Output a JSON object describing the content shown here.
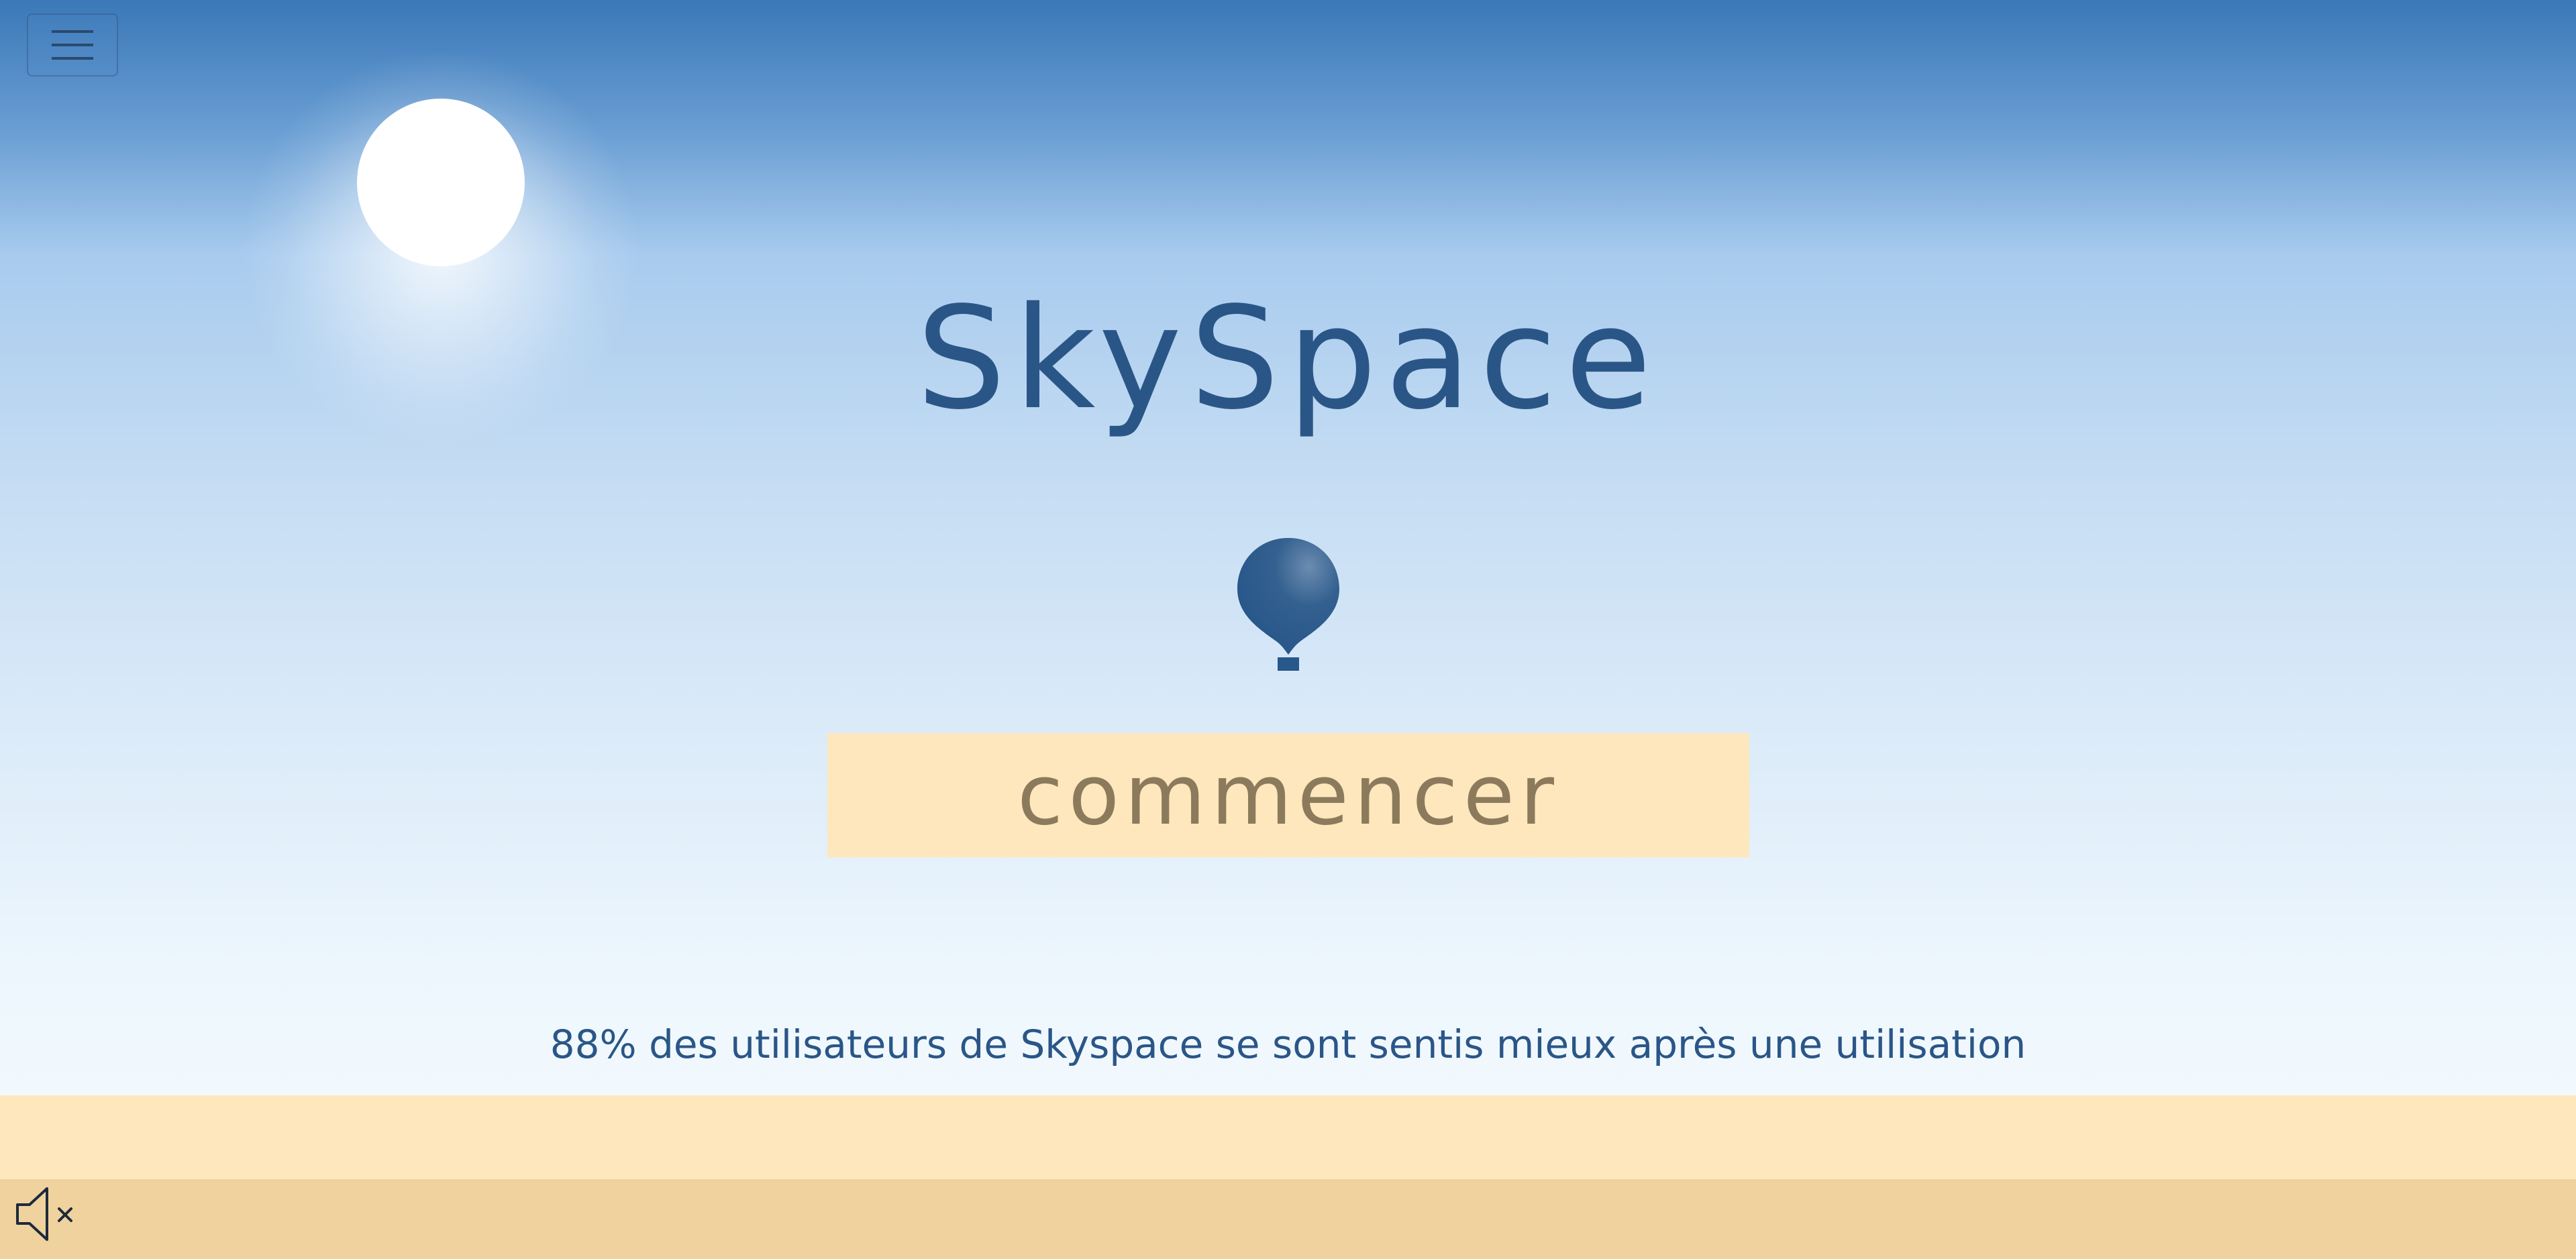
{
  "app": {
    "title": "SkySpace"
  },
  "header": {
    "menu_icon": "hamburger-menu-icon"
  },
  "hero": {
    "title": "SkySpace",
    "logo_icon": "hot-air-balloon-icon",
    "start_label": "commencer"
  },
  "stats": {
    "text": "88% des utilisateurs de Skyspace se sont sentis mieux après une utilisation"
  },
  "footer": {
    "sound_icon": "speaker-muted-icon"
  },
  "colors": {
    "sky_top": "#3a78b8",
    "sky_bottom": "#f1f9fe",
    "primary_text": "#2a5687",
    "button_bg": "#fee7bc",
    "button_text": "#8c7a5c",
    "sand_light": "#fee7bc",
    "sand_dark": "#efd29e",
    "sun": "#ffffff"
  }
}
